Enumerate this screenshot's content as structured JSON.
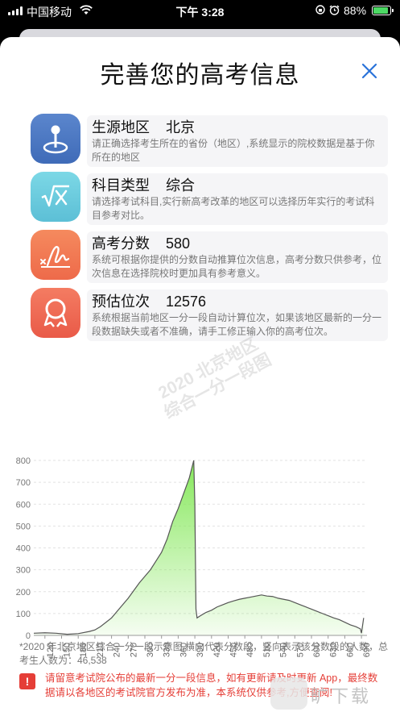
{
  "status_bar": {
    "carrier": "中国移动",
    "time": "下午 3:28",
    "battery": "88%",
    "battery_level": 0.88,
    "battery_color": "#4cd964"
  },
  "sheet": {
    "title": "完善您的高考信息",
    "close_icon": "close-icon",
    "accent": "#2a73d9"
  },
  "info_rows": [
    {
      "icon": "location-pin-icon",
      "label": "生源地区",
      "value": "北京",
      "desc": "请正确选择考生所在的省份（地区）,系统显示的院校数据是基于你所在的地区"
    },
    {
      "icon": "square-root-icon",
      "label": "科目类型",
      "value": "综合",
      "desc": "请选择考试科目,实行新高考改革的地区可以选择历年实行的考试科目参考对比。"
    },
    {
      "icon": "signature-icon",
      "label": "高考分数",
      "value": "580",
      "desc": "系统可根据你提供的分数自动推算位次信息，高考分数只供参考，位次信息在选择院校时更加具有参考意义。"
    },
    {
      "icon": "ribbon-badge-icon",
      "label": "预估位次",
      "value": "12576",
      "desc": "系统根据当前地区一分一段自动计算位次，如果该地区最新的一分一段数据缺失或者不准确，请手工修正输入你的高考位次。"
    }
  ],
  "chart_data": {
    "type": "area",
    "watermark_lines": [
      "2020 北京地区",
      "综合一分一段图"
    ],
    "x_ticks": [
      "120",
      "150",
      "180",
      "210",
      "240",
      "270",
      "300",
      "330",
      "360",
      "390",
      "420",
      "450",
      "480",
      "510",
      "540",
      "570",
      "600",
      "630",
      "660",
      "690"
    ],
    "y_ticks": [
      "0",
      "100",
      "200",
      "300",
      "400",
      "500",
      "600",
      "700",
      "800"
    ],
    "ylim": [
      0,
      800
    ],
    "xlim": [
      100,
      700
    ],
    "grid": true,
    "fill_color": "#86e85c",
    "line_color": "#555555",
    "x": [
      100,
      120,
      140,
      160,
      180,
      200,
      210,
      220,
      230,
      240,
      250,
      260,
      270,
      280,
      290,
      300,
      310,
      320,
      330,
      340,
      350,
      360,
      370,
      380,
      384,
      388,
      390,
      392,
      394,
      400,
      410,
      420,
      430,
      440,
      450,
      460,
      470,
      480,
      490,
      500,
      510,
      520,
      530,
      540,
      550,
      560,
      570,
      580,
      590,
      600,
      610,
      620,
      630,
      640,
      650,
      660,
      670,
      680,
      688,
      690,
      694
    ],
    "y": [
      10,
      12,
      10,
      5,
      8,
      18,
      25,
      40,
      60,
      80,
      110,
      140,
      170,
      205,
      240,
      270,
      300,
      340,
      380,
      440,
      520,
      580,
      650,
      720,
      760,
      800,
      600,
      120,
      80,
      90,
      105,
      115,
      130,
      140,
      150,
      158,
      165,
      170,
      175,
      180,
      185,
      180,
      178,
      170,
      165,
      160,
      150,
      140,
      130,
      120,
      110,
      100,
      90,
      80,
      72,
      60,
      48,
      40,
      30,
      10,
      80
    ]
  },
  "footnote": "*2020 年北京地区综合一分一段示意图,横向代表分数段，竖向表示该分数段的人数，总考生人数为：46,538",
  "warning": {
    "icon": "warning-icon",
    "text": "请留意考试院公布的最新一分一段信息，如有更新请及时更新 App，最终数据请以各地区的考试院官方发布为准，本系统仅供参考,方便查阅!"
  },
  "corner_watermark": {
    "icon": "download-site-logo-icon",
    "text": "旷下载"
  }
}
